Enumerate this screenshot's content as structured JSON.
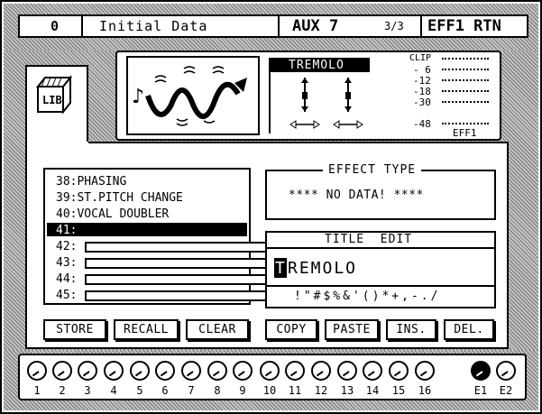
{
  "header": {
    "scene_number": "0",
    "scene_name": "Initial Data",
    "bus": "AUX 7",
    "page": "3/3",
    "channel": "EFF1 RTN"
  },
  "lib_icon": {
    "label": "LIB"
  },
  "effect_display": {
    "effect_name": "TREMOLO",
    "meter_labels": [
      "CLIP",
      "- 6",
      "-12",
      "-18",
      "-30",
      "-48"
    ],
    "meter_channel": "EFF1"
  },
  "library": {
    "items": [
      {
        "label": "38:PHASING"
      },
      {
        "label": "39:ST.PITCH CHANGE"
      },
      {
        "label": "40:VOCAL DOUBLER"
      },
      {
        "label": "41:"
      },
      {
        "label": "42:"
      },
      {
        "label": "43:"
      },
      {
        "label": "44:"
      },
      {
        "label": "45:"
      }
    ],
    "selected_index": 3
  },
  "effect_type": {
    "title": "EFFECT TYPE",
    "value": "**** NO DATA! ****"
  },
  "title_edit": {
    "title": "TITLE  EDIT",
    "cursor_char": "T",
    "value_rest": "REMOLO",
    "charset": "!\"#$%&'()*+,-./"
  },
  "buttons": {
    "store": "STORE",
    "recall": "RECALL",
    "clear": "CLEAR",
    "copy": "COPY",
    "paste": "PASTE",
    "ins": "INS.",
    "del": "DEL."
  },
  "knobs": {
    "labels": [
      "1",
      "2",
      "3",
      "4",
      "5",
      "6",
      "7",
      "8",
      "9",
      "10",
      "11",
      "12",
      "13",
      "14",
      "15",
      "16",
      "E1",
      "E2"
    ],
    "selected": "E1"
  }
}
